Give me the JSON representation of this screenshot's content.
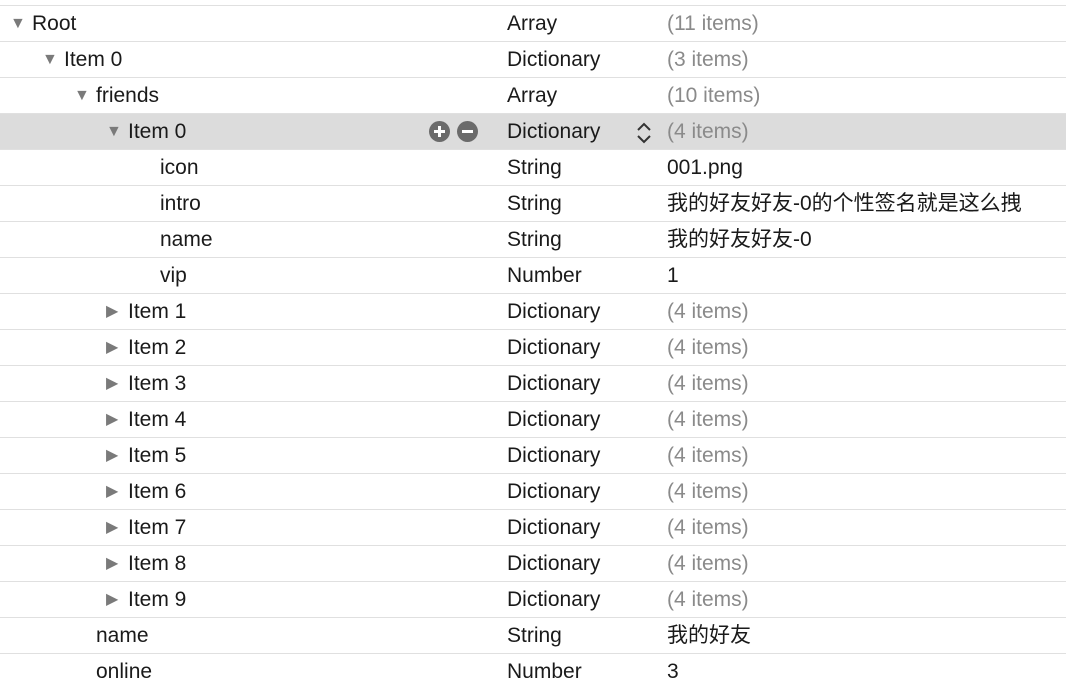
{
  "rows": [
    {
      "key": "Root",
      "type": "Array",
      "value": "(11 items)",
      "value_kind": "count",
      "depth": 0,
      "disclosure": "expanded",
      "selected": false
    },
    {
      "key": "Item 0",
      "type": "Dictionary",
      "value": "(3 items)",
      "value_kind": "count",
      "depth": 1,
      "disclosure": "expanded",
      "selected": false
    },
    {
      "key": "friends",
      "type": "Array",
      "value": "(10 items)",
      "value_kind": "count",
      "depth": 2,
      "disclosure": "expanded",
      "selected": false
    },
    {
      "key": "Item 0",
      "type": "Dictionary",
      "value": "(4 items)",
      "value_kind": "count",
      "depth": 3,
      "disclosure": "expanded",
      "selected": true
    },
    {
      "key": "icon",
      "type": "String",
      "value": "001.png",
      "value_kind": "plain",
      "depth": 4,
      "disclosure": "none",
      "selected": false
    },
    {
      "key": "intro",
      "type": "String",
      "value": "我的好友好友-0的个性签名就是这么拽",
      "value_kind": "plain",
      "depth": 4,
      "disclosure": "none",
      "selected": false
    },
    {
      "key": "name",
      "type": "String",
      "value": "我的好友好友-0",
      "value_kind": "plain",
      "depth": 4,
      "disclosure": "none",
      "selected": false
    },
    {
      "key": "vip",
      "type": "Number",
      "value": "1",
      "value_kind": "plain",
      "depth": 4,
      "disclosure": "none",
      "selected": false
    },
    {
      "key": "Item 1",
      "type": "Dictionary",
      "value": "(4 items)",
      "value_kind": "count",
      "depth": 3,
      "disclosure": "collapsed",
      "selected": false
    },
    {
      "key": "Item 2",
      "type": "Dictionary",
      "value": "(4 items)",
      "value_kind": "count",
      "depth": 3,
      "disclosure": "collapsed",
      "selected": false
    },
    {
      "key": "Item 3",
      "type": "Dictionary",
      "value": "(4 items)",
      "value_kind": "count",
      "depth": 3,
      "disclosure": "collapsed",
      "selected": false
    },
    {
      "key": "Item 4",
      "type": "Dictionary",
      "value": "(4 items)",
      "value_kind": "count",
      "depth": 3,
      "disclosure": "collapsed",
      "selected": false
    },
    {
      "key": "Item 5",
      "type": "Dictionary",
      "value": "(4 items)",
      "value_kind": "count",
      "depth": 3,
      "disclosure": "collapsed",
      "selected": false
    },
    {
      "key": "Item 6",
      "type": "Dictionary",
      "value": "(4 items)",
      "value_kind": "count",
      "depth": 3,
      "disclosure": "collapsed",
      "selected": false
    },
    {
      "key": "Item 7",
      "type": "Dictionary",
      "value": "(4 items)",
      "value_kind": "count",
      "depth": 3,
      "disclosure": "collapsed",
      "selected": false
    },
    {
      "key": "Item 8",
      "type": "Dictionary",
      "value": "(4 items)",
      "value_kind": "count",
      "depth": 3,
      "disclosure": "collapsed",
      "selected": false
    },
    {
      "key": "Item 9",
      "type": "Dictionary",
      "value": "(4 items)",
      "value_kind": "count",
      "depth": 3,
      "disclosure": "collapsed",
      "selected": false
    },
    {
      "key": "name",
      "type": "String",
      "value": "我的好友",
      "value_kind": "plain",
      "depth": 2,
      "disclosure": "none",
      "selected": false
    },
    {
      "key": "online",
      "type": "Number",
      "value": "3",
      "value_kind": "plain",
      "depth": 2,
      "disclosure": "none",
      "selected": false
    }
  ],
  "icons": {
    "expanded": "disclosure-triangle-expanded-icon",
    "collapsed": "disclosure-triangle-collapsed-icon",
    "add": "plus-circle-icon",
    "remove": "minus-circle-icon",
    "type_menu": "up-down-chevron-icon"
  },
  "colors": {
    "selected_row": "#dcdcdc",
    "row_separator": "#e0e0e0",
    "count_text": "#8a8a8a",
    "disclosure": "#7a7a7a",
    "row_button": "#6b6b6b"
  }
}
